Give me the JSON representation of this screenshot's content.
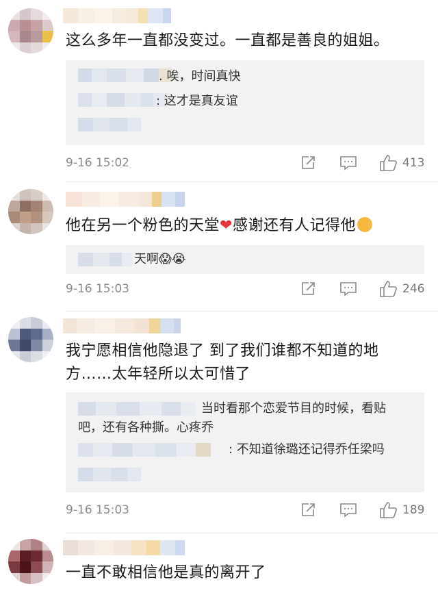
{
  "comments": [
    {
      "text": "这么多年一直都没变过。一直都是善良的姐姐。",
      "replies": [
        {
          "suffix": ". 唉，时间真快"
        },
        {
          "suffix": ": 这才是真友谊"
        }
      ],
      "time": "9-16 15:02",
      "likes": "413"
    },
    {
      "text_a": "他在另一个粉色的天堂",
      "text_b": "感谢还有人记得他",
      "replies": [
        {
          "suffix": "天啊😱😭"
        }
      ],
      "time": "9-16 15:03",
      "likes": "246"
    },
    {
      "text_line1": "我宁愿相信他隐退了 到了我们谁都不知道的地",
      "text_line2": "方……太年轻所以太可惜了",
      "replies": [
        {
          "line1": "当时看那个恋爱节目的时候，看贴",
          "line2": "吧，还有各种撕。心疼乔"
        },
        {
          "suffix": ": 不知道徐璐还记得乔任梁吗"
        }
      ],
      "time": "9-16 15:03",
      "likes": "189"
    },
    {
      "text": "一直不敢相信他是真的离开了"
    }
  ],
  "icons": {
    "repost": "share-icon",
    "comment": "comment-icon",
    "like": "thumbs-up-icon",
    "heart": "red-heart-emoji",
    "surprised": "surprised-face-emoji"
  },
  "colors": {
    "heart": "#e8323c",
    "reply_bg": "#f2f2f2",
    "meta_text": "#8a8a8a"
  }
}
